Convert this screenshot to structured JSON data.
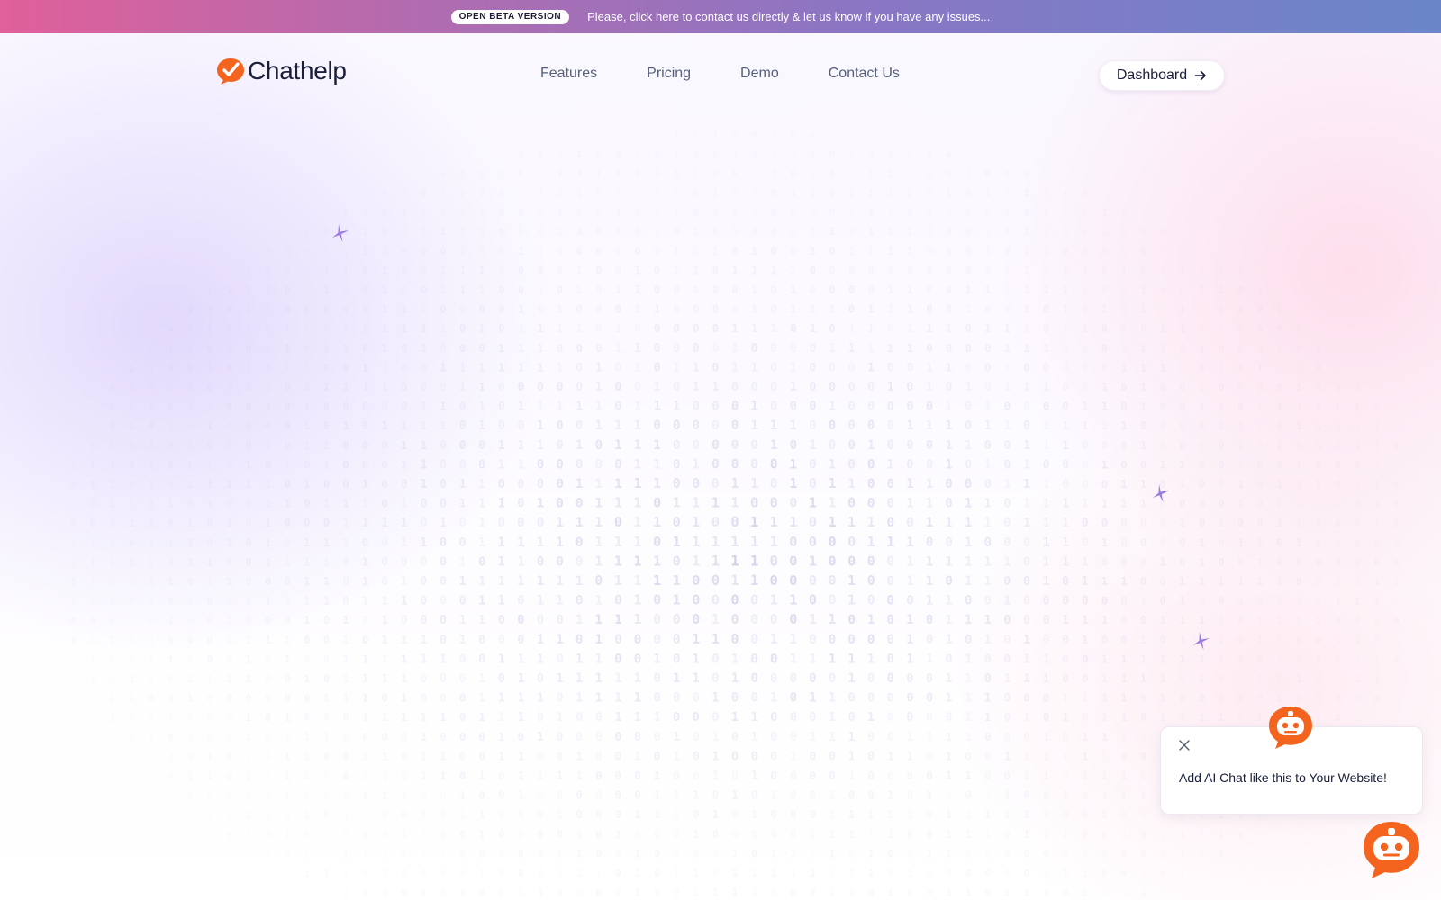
{
  "banner": {
    "badge": "OPEN BETA VERSION",
    "message": "Please, click here to contact us directly & let us know if you have any issues..."
  },
  "brand": {
    "name": "Chathelp",
    "logo_icon": "chat-bubble-check-icon",
    "accent_color": "#f5641e"
  },
  "nav": {
    "items": [
      {
        "label": "Features"
      },
      {
        "label": "Pricing"
      },
      {
        "label": "Demo"
      },
      {
        "label": "Contact Us"
      }
    ]
  },
  "header": {
    "dashboard_label": "Dashboard",
    "dashboard_icon": "arrow-right-icon"
  },
  "chat_widget": {
    "prompt": " Add AI Chat like this to Your Website!",
    "close_icon": "close-icon",
    "avatar_icon": "robot-icon",
    "launcher_icon": "robot-icon",
    "robot_color": "#f5641e"
  },
  "decor": {
    "sparkle_icon": "sparkle-icon",
    "sparkle_color": "#9a7be0",
    "binary_color": "#8e84c4"
  }
}
